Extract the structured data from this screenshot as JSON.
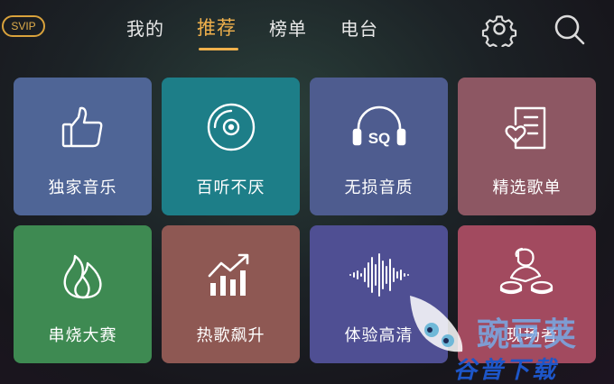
{
  "header": {
    "badge": "SVIP",
    "tabs": [
      {
        "label": "我的",
        "active": false
      },
      {
        "label": "推荐",
        "active": true
      },
      {
        "label": "榜单",
        "active": false
      },
      {
        "label": "电台",
        "active": false
      }
    ],
    "settings_icon": "gear-icon",
    "search_icon": "search-icon",
    "accent": "#f0b14c"
  },
  "tiles": [
    {
      "label": "独家音乐",
      "icon": "thumbs-up-icon",
      "color": "#4f6596"
    },
    {
      "label": "百听不厌",
      "icon": "vinyl-disc-icon",
      "color": "#1d7e88"
    },
    {
      "label": "无损音质",
      "icon": "sq-headphones-icon",
      "color": "#4e5c8f"
    },
    {
      "label": "精选歌单",
      "icon": "heart-playlist-icon",
      "color": "#8d5763"
    },
    {
      "label": "串烧大赛",
      "icon": "flame-icon",
      "color": "#3e8a52"
    },
    {
      "label": "热歌飙升",
      "icon": "rising-chart-icon",
      "color": "#8e5853"
    },
    {
      "label": "体验高清",
      "icon": "audio-wave-icon",
      "color": "#4f4f93"
    },
    {
      "label": "现场者",
      "icon": "dj-icon",
      "color": "#a24a5f"
    }
  ],
  "watermark": {
    "brand": "豌豆荚",
    "sub": "谷普下载"
  }
}
